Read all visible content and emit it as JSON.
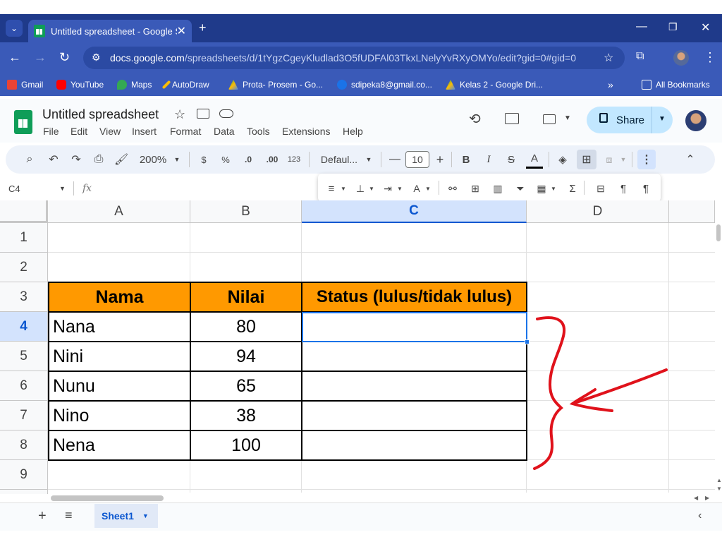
{
  "browser": {
    "tab_title": "Untitled spreadsheet - Google S",
    "url_domain": "docs.google.com",
    "url_path": "/spreadsheets/d/1tYgzCgeyKludlad3O5fUDFAl03TkxLNelyYvRXyOMYo/edit?gid=0#gid=0",
    "bookmarks": [
      "Gmail",
      "YouTube",
      "Maps",
      "AutoDraw",
      "Prota- Prosem - Go...",
      "sdipeka8@gmail.co...",
      "Kelas 2 - Google Dri..."
    ],
    "all_bookmarks": "All Bookmarks"
  },
  "sheets": {
    "title": "Untitled spreadsheet",
    "menu": [
      "File",
      "Edit",
      "View",
      "Insert",
      "Format",
      "Data",
      "Tools",
      "Extensions",
      "Help"
    ],
    "share_label": "Share",
    "toolbar": {
      "zoom": "200%",
      "currency": "$",
      "percent": "%",
      "dec_decrease": ".0",
      "dec_increase": ".00",
      "number_format": "123",
      "font": "Defaul...",
      "font_size": "10",
      "bold": "B",
      "italic": "I",
      "strike": "S",
      "text_color": "A"
    },
    "name_box": "C4",
    "fx": "fx",
    "columns": [
      "A",
      "B",
      "C",
      "D"
    ],
    "rows": [
      "1",
      "2",
      "3",
      "4",
      "5",
      "6",
      "7",
      "8",
      "9"
    ],
    "selected_column": "C",
    "selected_row": "4",
    "table": {
      "headers": [
        "Nama",
        "Nilai",
        "Status (lulus/tidak lulus)"
      ],
      "rows": [
        {
          "nama": "Nana",
          "nilai": "80",
          "status": ""
        },
        {
          "nama": "Nini",
          "nilai": "94",
          "status": ""
        },
        {
          "nama": "Nunu",
          "nilai": "65",
          "status": ""
        },
        {
          "nama": "Nino",
          "nilai": "38",
          "status": ""
        },
        {
          "nama": "Nena",
          "nilai": "100",
          "status": ""
        }
      ],
      "header_color": "#ff9900"
    },
    "sheet_tab": "Sheet1",
    "annotation_color": "#e0121b"
  }
}
